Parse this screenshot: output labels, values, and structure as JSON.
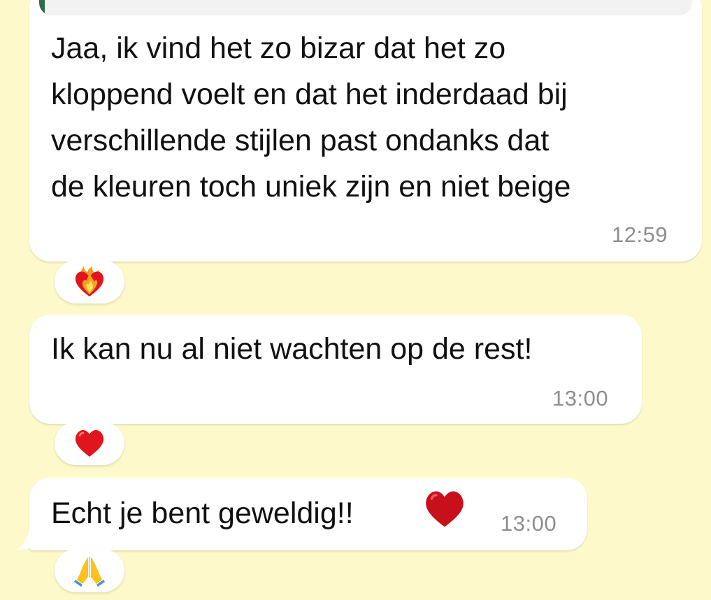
{
  "colors": {
    "chat_background": "#fdf9cb",
    "bubble_background": "#ffffff",
    "timestamp": "#8e8e8e",
    "quote_bar": "#2f6b45",
    "heart_red": "#e0161e"
  },
  "messages": [
    {
      "text": "Jaa, ik vind het zo bizar dat het zo\nkloppend voelt en dat het inderdaad bij\nverschillende stijlen past ondanks dat\nde kleuren toch uniek zijn en niet beige",
      "time": "12:59",
      "reaction_icon": "heart-on-fire-icon"
    },
    {
      "text": "Ik kan nu al niet wachten op de rest!",
      "time": "13:00",
      "reaction_icon": "red-heart-icon"
    },
    {
      "text": "Echt je bent geweldig!!",
      "inline_icon": "red-heart-icon",
      "time": "13:00",
      "reaction_icon": "folded-hands-icon"
    }
  ]
}
